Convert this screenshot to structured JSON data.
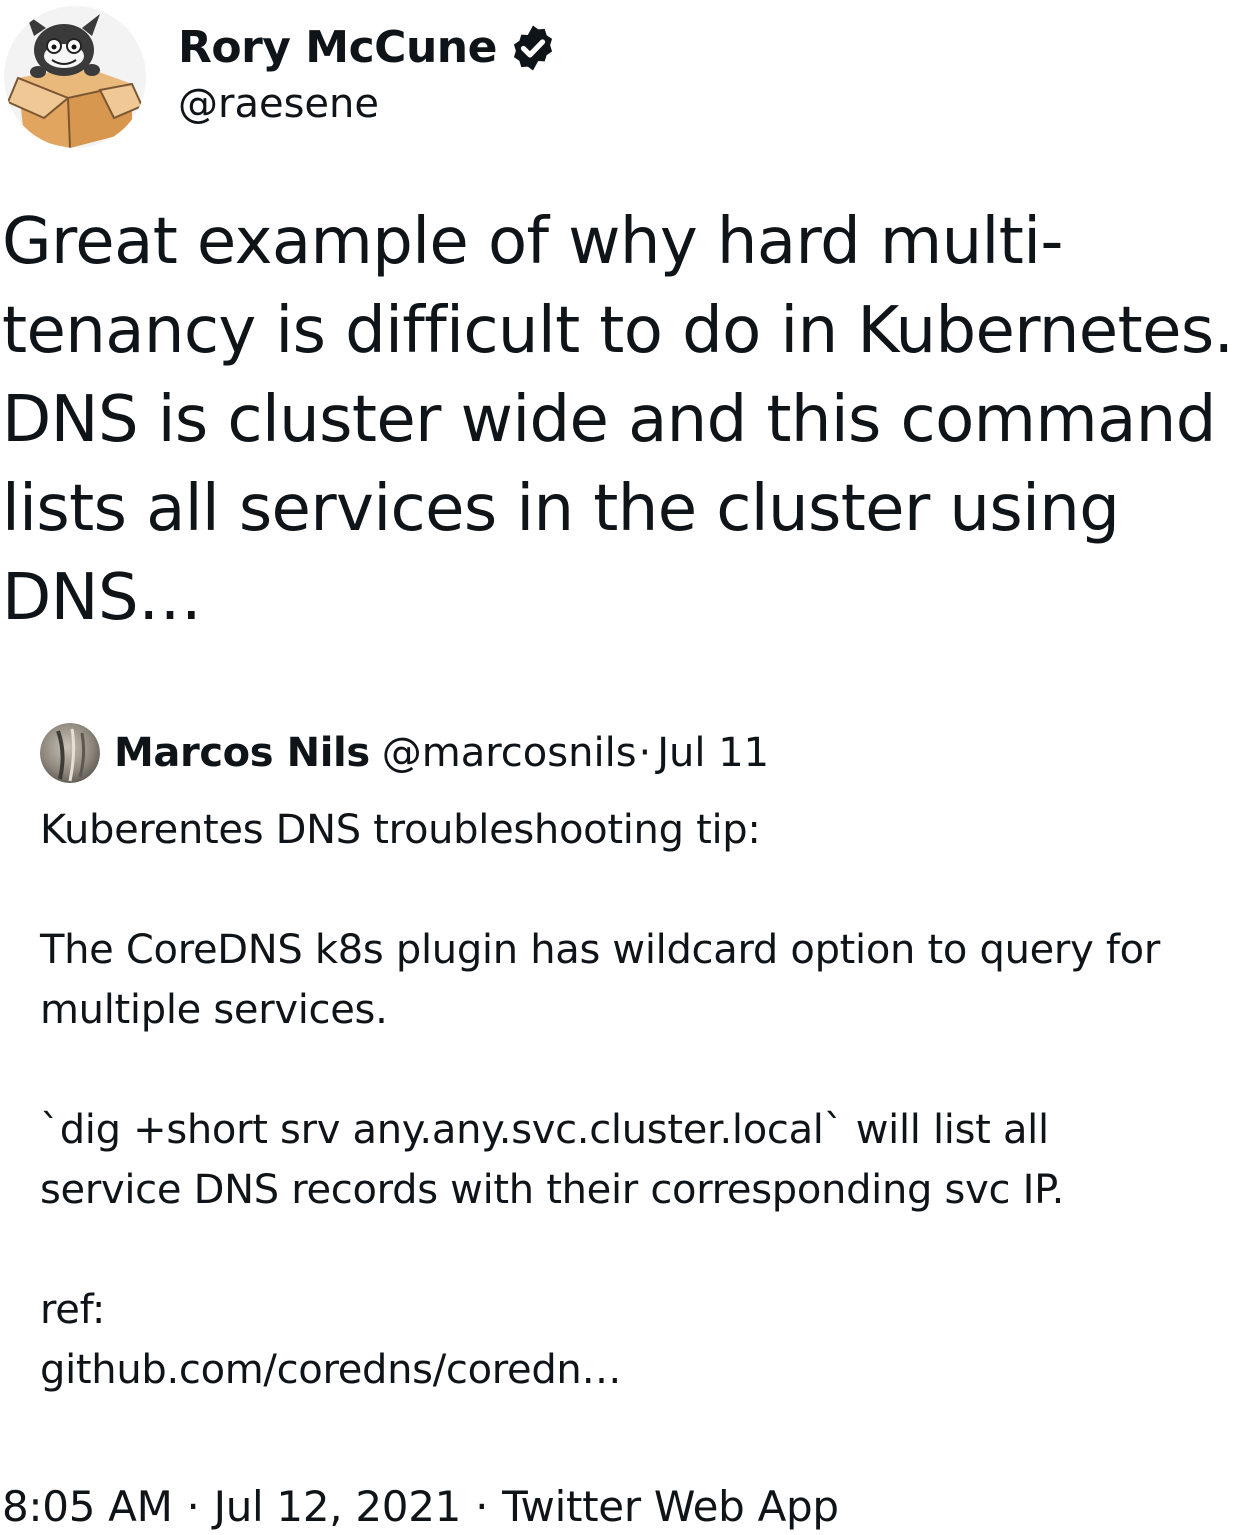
{
  "author": {
    "display_name": "Rory McCune",
    "handle": "@raesene",
    "verified": true,
    "avatar_icon": "cartoon-box-character-avatar"
  },
  "tweet": {
    "text": "Great example of why hard multi-\ntenancy is difficult to do in Kubernetes.\nDNS is cluster wide and this command\nlists all services in the cluster using\nDNS…",
    "time": "8:05 AM",
    "separator": "·",
    "date": "Jul 12, 2021",
    "source": "Twitter Web App"
  },
  "quoted_tweet": {
    "display_name": "Marcos Nils",
    "handle": "@marcosnils",
    "separator": "·",
    "date": "Jul 11",
    "avatar_icon": "user-photo-avatar",
    "paragraphs": [
      "Kuberentes DNS troubleshooting tip:",
      "The CoreDNS k8s plugin has wildcard option to query for\nmultiple services.",
      "`dig +short srv any.any.svc.cluster.local` will list all\nservice DNS records with their corresponding svc IP."
    ],
    "ref_label": "ref:",
    "ref_link": "github.com/coredns/coredn…"
  },
  "colors": {
    "text": "#0f1419",
    "verified_badge": "#0f1419",
    "background": "#ffffff"
  }
}
